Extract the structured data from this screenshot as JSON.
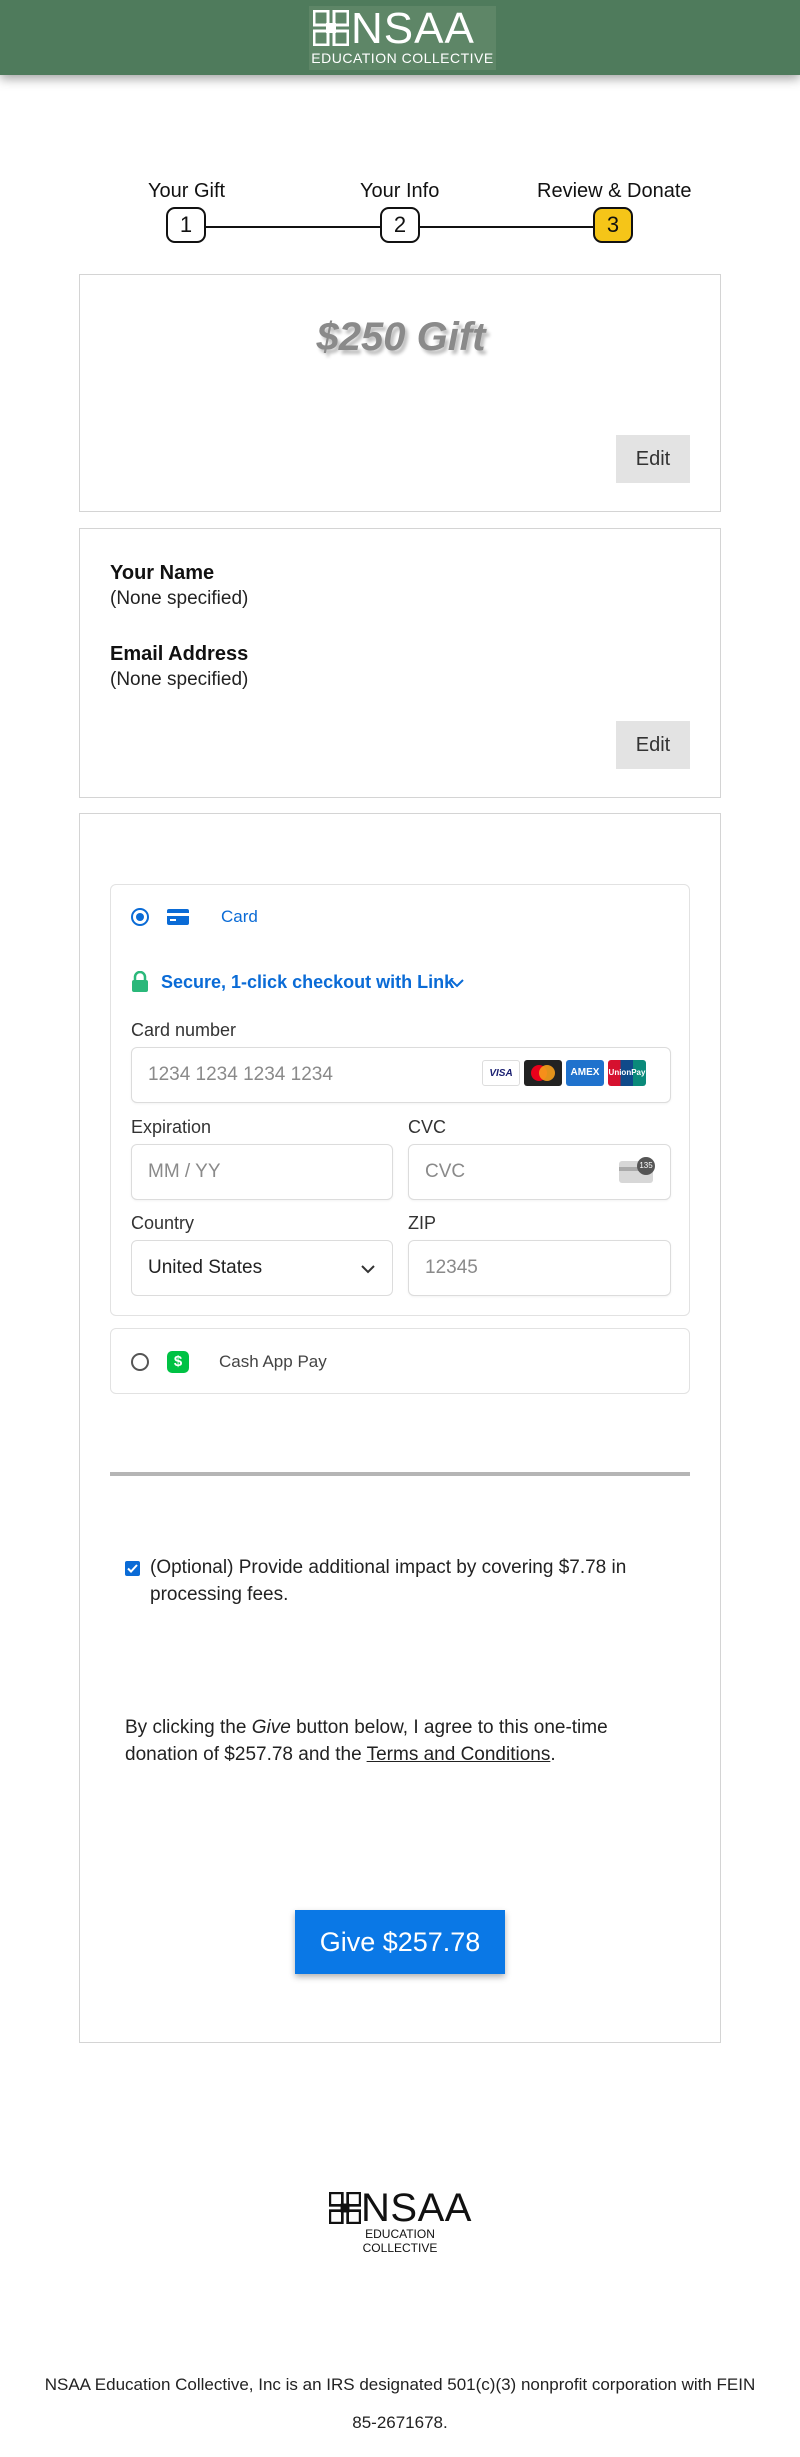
{
  "header": {
    "logo_word": "NSAA",
    "logo_sub": "EDUCATION COLLECTIVE"
  },
  "steps": [
    {
      "label": "Your Gift",
      "number": "1"
    },
    {
      "label": "Your Info",
      "number": "2"
    },
    {
      "label": "Review & Donate",
      "number": "3"
    }
  ],
  "gift": {
    "amount_text": "$250 Gift",
    "edit_label": "Edit"
  },
  "info": {
    "name_label": "Your Name",
    "name_value": "(None specified)",
    "email_label": "Email Address",
    "email_value": "(None specified)",
    "edit_label": "Edit"
  },
  "payment": {
    "card_label": "Card",
    "link_text": "Secure, 1-click checkout with Link",
    "card_number_label": "Card number",
    "card_number_placeholder": "1234 1234 1234 1234",
    "brands": [
      "VISA",
      "",
      "AMEX",
      "UnionPay"
    ],
    "expiration_label": "Expiration",
    "expiration_placeholder": "MM / YY",
    "cvc_label": "CVC",
    "cvc_placeholder": "CVC",
    "cvc_badge": "135",
    "country_label": "Country",
    "country_value": "United States",
    "zip_label": "ZIP",
    "zip_placeholder": "12345",
    "cashapp_label": "Cash App Pay",
    "cashapp_symbol": "$"
  },
  "fee_text": "(Optional) Provide additional impact by covering $7.78 in processing fees.",
  "agree": {
    "prefix": "By clicking the ",
    "give_word": "Give",
    "middle": " button below, I agree to this one-time donation of $257.78 and the ",
    "terms_link": "Terms and Conditions",
    "suffix": "."
  },
  "give_button": "Give $257.78",
  "footer": {
    "logo_word": "NSAA",
    "logo_sub": "EDUCATION COLLECTIVE",
    "text": "NSAA Education Collective, Inc is an IRS designated 501(c)(3) nonprofit corporation with FEIN 85-2671678."
  },
  "colors": {
    "header_bg": "#4f7b5c",
    "accent": "#0a78e6",
    "step_active": "#f5c518",
    "link_green": "#2ab87a"
  }
}
